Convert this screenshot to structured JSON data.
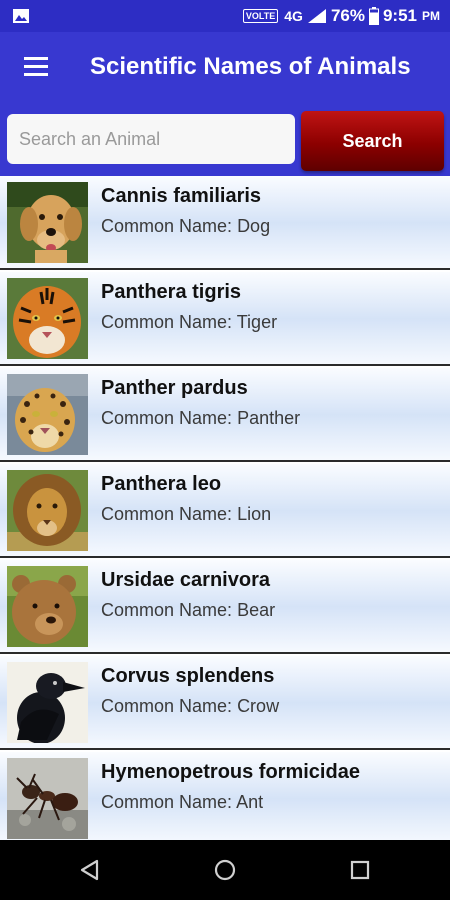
{
  "status_bar": {
    "volte": "VOLTE",
    "network": "4G",
    "battery": "76%",
    "time": "9:51",
    "ampm": "PM"
  },
  "app_bar": {
    "title": "Scientific Names of Animals"
  },
  "search": {
    "placeholder": "Search an Animal",
    "value": "",
    "button_label": "Search"
  },
  "list": {
    "common_prefix": "Common Name:",
    "items": [
      {
        "scientific": "Cannis familiaris",
        "common": "Dog",
        "icon": "dog-photo"
      },
      {
        "scientific": "Panthera tigris",
        "common": "Tiger",
        "icon": "tiger-photo"
      },
      {
        "scientific": "Panther pardus",
        "common": "Panther",
        "icon": "leopard-photo"
      },
      {
        "scientific": "Panthera leo",
        "common": "Lion",
        "icon": "lion-photo"
      },
      {
        "scientific": "Ursidae carnivora",
        "common": "Bear",
        "icon": "bear-photo"
      },
      {
        "scientific": "Corvus splendens",
        "common": "Crow",
        "icon": "crow-photo"
      },
      {
        "scientific": "Hymenopetrous formicidae",
        "common": "Ant",
        "icon": "ant-photo"
      }
    ]
  },
  "colors": {
    "header": "#3838d0",
    "status_bar": "#2d2dc4",
    "search_button": "#a00000",
    "row_gradient_mid": "#d5e3f7"
  }
}
